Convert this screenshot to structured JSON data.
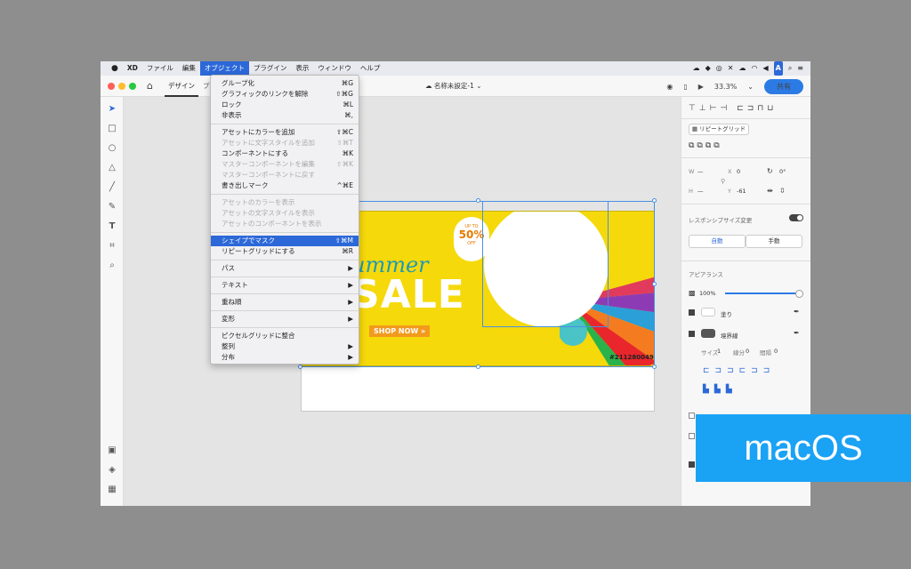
{
  "menubar": {
    "apple": "",
    "items": [
      "XD",
      "ファイル",
      "編集",
      "オブジェクト",
      "プラグイン",
      "表示",
      "ウィンドウ",
      "ヘルプ"
    ],
    "active_index": 3,
    "right_icons": [
      "cloud-sync-icon",
      "dropbox-icon",
      "creative-cloud-icon",
      "x-icon",
      "cloud-upload-icon",
      "wifi-icon",
      "volume-icon"
    ],
    "input_badge": "A"
  },
  "toolbar": {
    "home_icon": "⌂",
    "tab_design": "デザイン",
    "tab_second": "プ",
    "doc_title": "名称未設定-1",
    "zoom": "33.3%",
    "share": "共有"
  },
  "object_menu": [
    {
      "label": "グループ化",
      "shortcut": "⌘G",
      "disabled": false
    },
    {
      "label": "グラフィックのリンクを解除",
      "shortcut": "⇧⌘G",
      "disabled": false
    },
    {
      "label": "ロック",
      "shortcut": "⌘L",
      "disabled": false
    },
    {
      "label": "非表示",
      "shortcut": "⌘,",
      "disabled": false
    },
    {
      "sep": true
    },
    {
      "label": "アセットにカラーを追加",
      "shortcut": "⇧⌘C",
      "disabled": false
    },
    {
      "label": "アセットに文字スタイルを追加",
      "shortcut": "⇧⌘T",
      "disabled": true
    },
    {
      "label": "コンポーネントにする",
      "shortcut": "⌘K",
      "disabled": false
    },
    {
      "label": "マスターコンポーネントを編集",
      "shortcut": "⇧⌘K",
      "disabled": true
    },
    {
      "label": "マスターコンポーネントに戻す",
      "shortcut": "",
      "disabled": true
    },
    {
      "label": "書き出しマーク",
      "shortcut": "^⌘E",
      "disabled": false
    },
    {
      "sep": true
    },
    {
      "label": "アセットのカラーを表示",
      "shortcut": "",
      "disabled": true
    },
    {
      "label": "アセットの文字スタイルを表示",
      "shortcut": "",
      "disabled": true
    },
    {
      "label": "アセットのコンポーネントを表示",
      "shortcut": "",
      "disabled": true
    },
    {
      "sep": true
    },
    {
      "label": "シェイプでマスク",
      "shortcut": "⇧⌘M",
      "disabled": false,
      "highlighted": true
    },
    {
      "label": "リピートグリッドにする",
      "shortcut": "⌘R",
      "disabled": false
    },
    {
      "sep": true
    },
    {
      "label": "パス",
      "shortcut": "▶",
      "disabled": false
    },
    {
      "sep": true
    },
    {
      "label": "テキスト",
      "shortcut": "▶",
      "disabled": false
    },
    {
      "sep": true
    },
    {
      "label": "重ね順",
      "shortcut": "▶",
      "disabled": false
    },
    {
      "sep": true
    },
    {
      "label": "変形",
      "shortcut": "▶",
      "disabled": false
    },
    {
      "sep": true
    },
    {
      "label": "ピクセルグリッドに整合",
      "shortcut": "",
      "disabled": false
    },
    {
      "label": "整列",
      "shortcut": "▶",
      "disabled": false
    },
    {
      "label": "分布",
      "shortcut": "▶",
      "disabled": false
    }
  ],
  "banner": {
    "summer": "ummer",
    "sale": "SALE",
    "shop": "SHOP NOW »",
    "sku": "#211280049",
    "upto": "UP TO",
    "pct": "50%",
    "off": "OFF"
  },
  "right_panel": {
    "repeat_grid": "リピートグリッド",
    "w_label": "W",
    "w_value": "—",
    "h_label": "H",
    "h_value": "—",
    "x_label": "X",
    "x_value": "0",
    "y_label": "Y",
    "y_value": "-61",
    "rotation": "0°",
    "responsive": "レスポンシブサイズ変更",
    "auto": "自動",
    "manual": "手動",
    "appearance": "アピアランス",
    "opacity": "100%",
    "fill": "塗り",
    "border": "境界線",
    "size_label": "サイズ",
    "size_value": "1",
    "dash_label": "線分",
    "dash_value": "0",
    "gap_label": "間隔",
    "gap_value": "0"
  },
  "os_badge": "macOS"
}
